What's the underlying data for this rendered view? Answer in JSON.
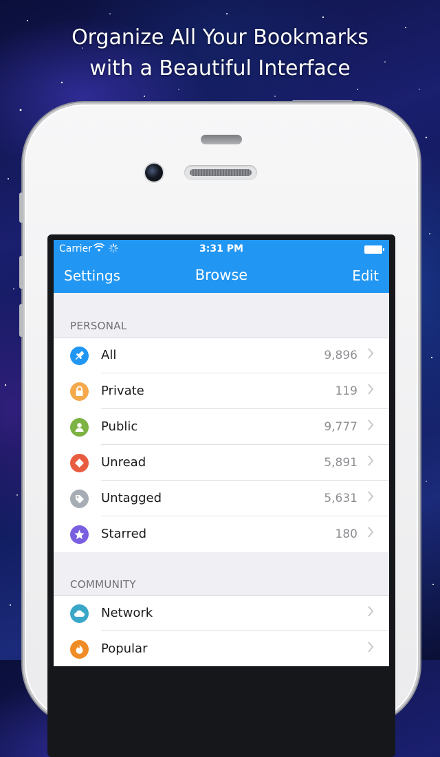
{
  "headline": {
    "line1": "Organize All Your Bookmarks",
    "line2": "with a Beautiful Interface"
  },
  "status_bar": {
    "carrier": "Carrier",
    "time": "3:31 PM"
  },
  "nav": {
    "left": "Settings",
    "title": "Browse",
    "right": "Edit"
  },
  "colors": {
    "accent": "#2196f3",
    "all": "#2196f3",
    "private": "#f5a94c",
    "public": "#7cb342",
    "unread": "#e85d3f",
    "untagged": "#a7adb5",
    "starred": "#7a5fe0",
    "network": "#3aa7c9",
    "popular": "#f08c25"
  },
  "sections": {
    "personal": {
      "header": "PERSONAL",
      "items": [
        {
          "label": "All",
          "count": "9,896",
          "icon": "pin-icon"
        },
        {
          "label": "Private",
          "count": "119",
          "icon": "lock-icon"
        },
        {
          "label": "Public",
          "count": "9,777",
          "icon": "person-icon"
        },
        {
          "label": "Unread",
          "count": "5,891",
          "icon": "diamond-icon"
        },
        {
          "label": "Untagged",
          "count": "5,631",
          "icon": "tag-icon"
        },
        {
          "label": "Starred",
          "count": "180",
          "icon": "star-icon"
        }
      ]
    },
    "community": {
      "header": "COMMUNITY",
      "items": [
        {
          "label": "Network",
          "icon": "cloud-icon"
        },
        {
          "label": "Popular",
          "icon": "flame-icon"
        }
      ]
    }
  }
}
